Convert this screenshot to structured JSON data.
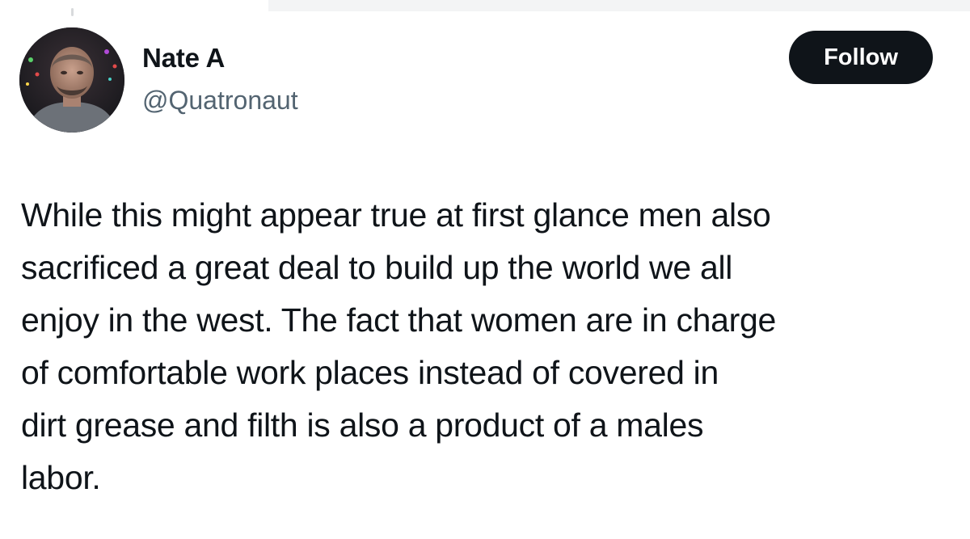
{
  "author": {
    "name": "Nate A",
    "handle": "@Quatronaut"
  },
  "follow_button": {
    "label": "Follow"
  },
  "tweet": {
    "lines": [
      "While this might appear true at first glance men also",
      "sacrificed a great deal to build up the world we all",
      "enjoy in the west. The fact that women are in charge",
      "of comfortable work places instead of covered in",
      "dirt grease and filth is also a product of a males",
      "labor."
    ]
  },
  "colors": {
    "text": "#0f1419",
    "secondary_text": "#536471",
    "button_bg": "#0f1419",
    "button_text": "#ffffff"
  },
  "icons": {
    "avatar": "avatar-photo"
  }
}
